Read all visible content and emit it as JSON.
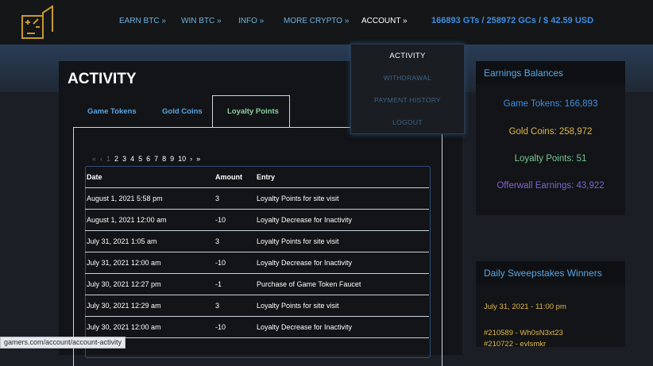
{
  "nav": {
    "items": [
      "EARN BTC »",
      "WIN BTC »",
      "INFO »",
      "MORE CRYPTO »"
    ],
    "account": "ACCOUNT »",
    "balance": "166893 GTs / 258972 GCs / $ 42.59 USD"
  },
  "dropdown": {
    "items": [
      "ACTIVITY",
      "WITHDRAWAL",
      "PAYMENT HISTORY",
      "LOGOUT"
    ]
  },
  "page": {
    "title": "ACTIVITY",
    "tabs": [
      "Game Tokens",
      "Gold Coins",
      "Loyalty Points"
    ]
  },
  "pager": {
    "first": "«",
    "prev": "‹",
    "pages": [
      "1",
      "2",
      "3",
      "4",
      "5",
      "6",
      "7",
      "8",
      "9",
      "10"
    ],
    "next": "›",
    "last": "»"
  },
  "table": {
    "headers": [
      "Date",
      "Amount",
      "Entry"
    ],
    "rows": [
      [
        "August 1, 2021 5:58 pm",
        "3",
        "Loyalty Points for site visit"
      ],
      [
        "August 1, 2021 12:00 am",
        "-10",
        "Loyalty Decrease for Inactivity"
      ],
      [
        "July 31, 2021 1:05 am",
        "3",
        "Loyalty Points for site visit"
      ],
      [
        "July 31, 2021 12:00 am",
        "-10",
        "Loyalty Decrease for Inactivity"
      ],
      [
        "July 30, 2021 12:27 pm",
        "-1",
        "Purchase of Game Token Faucet"
      ],
      [
        "July 30, 2021 12:29 am",
        "3",
        "Loyalty Points for site visit"
      ],
      [
        "July 30, 2021 12:00 am",
        "-10",
        "Loyalty Decrease for Inactivity"
      ]
    ]
  },
  "earnings": {
    "title": "Earnings Balances",
    "game_tokens": "Game Tokens: 166,893",
    "gold_coins": "Gold Coins: 258,972",
    "loyalty_points": "Loyalty Points: 51",
    "offerwall": "Offerwall Earnings: 43,922",
    "colors": {
      "game_tokens": "#3f8ee0",
      "gold_coins": "#e0b84a",
      "loyalty_points": "#78c893",
      "offerwall": "#7f63cf"
    }
  },
  "winners": {
    "title": "Daily Sweepstakes Winners",
    "date": "July 31, 2021 - 11:00 pm",
    "entries": [
      "#210589 - Wh0sN3xt23",
      "#210722 - evlsmkr"
    ]
  },
  "status_bar": {
    "url": "gamers.com/account/account-activity"
  }
}
